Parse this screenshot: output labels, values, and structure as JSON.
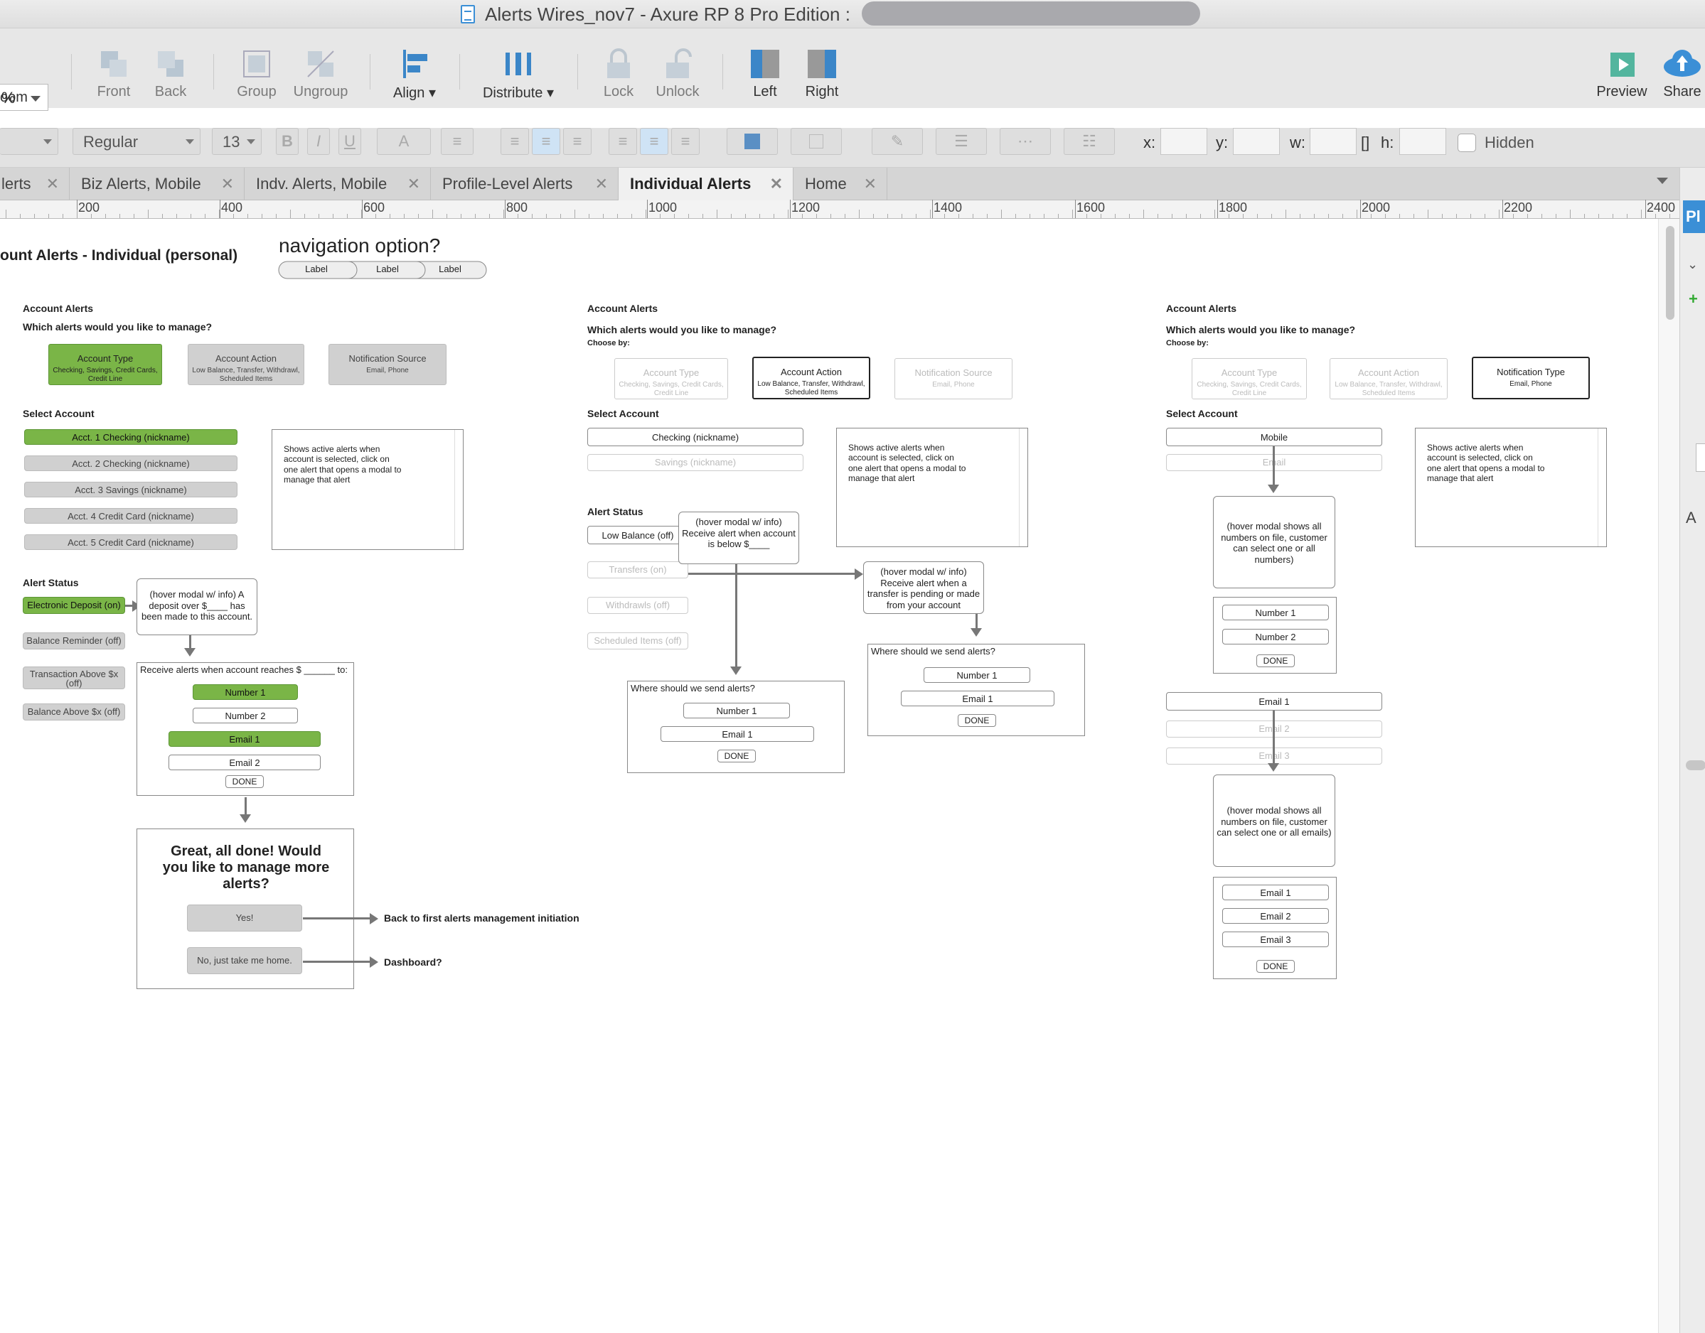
{
  "window": {
    "title": "Alerts Wires_nov7 - Axure RP 8 Pro Edition :"
  },
  "toolbar": {
    "zoom_value": "%",
    "zoom_label": "oom",
    "front": "Front",
    "back": "Back",
    "group": "Group",
    "ungroup": "Ungroup",
    "align": "Align ▾",
    "distribute": "Distribute ▾",
    "lock": "Lock",
    "unlock": "Unlock",
    "left": "Left",
    "right": "Right",
    "preview": "Preview",
    "share": "Share"
  },
  "format": {
    "font_style": "Regular",
    "font_size": "13",
    "bold": "B",
    "italic": "I",
    "underline": "U",
    "font_color": "A",
    "x_label": "x:",
    "y_label": "y:",
    "w_label": "w:",
    "h_label": "h:",
    "hidden_label": "Hidden"
  },
  "tabs": [
    "lerts",
    "Biz Alerts, Mobile",
    "Indv. Alerts, Mobile",
    "Profile-Level Alerts",
    "Individual Alerts",
    "Home"
  ],
  "ruler": [
    "200",
    "400",
    "600",
    "800",
    "1000",
    "1200",
    "1400",
    "1600",
    "1800",
    "2000",
    "2200",
    "2400"
  ],
  "rightpanel": {
    "tab": "Pl",
    "letter": "A"
  },
  "canvas": {
    "page_title": "ount Alerts - Individual (personal)",
    "nav_title": "navigation option?",
    "nav_labels": [
      "Label",
      "Label",
      "Label"
    ],
    "account_alerts": "Account Alerts",
    "which_alerts": "Which alerts would you like to manage?",
    "choose_by": "Choose by:",
    "cards": {
      "type": "Account Type",
      "type_sub": "Checking, Savings, Credit Cards, Credit Line",
      "action": "Account Action",
      "action_sub": "Low Balance, Transfer, Withdrawl, Scheduled Items",
      "source": "Notification Source",
      "source_sub": "Email, Phone",
      "ntype": "Notification Type",
      "ntype_sub": "Email, Phone"
    },
    "select_account": "Select Account",
    "accounts": [
      "Acct. 1 Checking (nickname)",
      "Acct. 2  Checking (nickname)",
      "Acct. 3 Savings (nickname)",
      "Acct. 4 Credit Card (nickname)",
      "Acct. 5 Credit Card (nickname)"
    ],
    "active_note": "Shows active alerts when account is selected, click on one alert that opens a modal to manage that alert",
    "alert_status": "Alert Status",
    "statuses1": [
      "Electronic Deposit (on)",
      "Balance Reminder  (off)",
      "Transaction Above $x (off)",
      "Balance Above $x (off)"
    ],
    "hover_deposit": "(hover modal w/ info) A deposit over $____ has been made to this account.",
    "receive_reaches": "Receive alerts when account reaches $ ______ to:",
    "number1": "Number 1",
    "number2": "Number 2",
    "email1": "Email 1",
    "email2": "Email 2",
    "email3": "Email 3",
    "done": "DONE",
    "great": "Great, all done! Would you like to manage more alerts?",
    "yes": "Yes!",
    "no": "No, just take me home.",
    "back_first": "Back to first alerts management initiation",
    "dashboard": "Dashboard?",
    "col2_accounts": [
      "Checking (nickname)",
      "Savings (nickname)"
    ],
    "statuses2": [
      "Low Balance (off)",
      "Transfers (on)",
      "Withdrawls (off)",
      "Scheduled Items (off)"
    ],
    "hover_low": "(hover modal w/ info) Receive alert when account is below $____",
    "hover_transfer": "(hover modal w/ info) Receive alert when a transfer is pending or made from your account",
    "where_send": "Where should we send alerts?",
    "col3_phones": [
      "Mobile",
      "Email"
    ],
    "hover_numbers": "(hover modal shows all numbers on file, customer can select one or all numbers)",
    "col3_emails": [
      "Email 1",
      "Email 2",
      "Email 3"
    ],
    "hover_emails": "(hover modal shows all numbers on file, customer can select one or all emails)"
  }
}
